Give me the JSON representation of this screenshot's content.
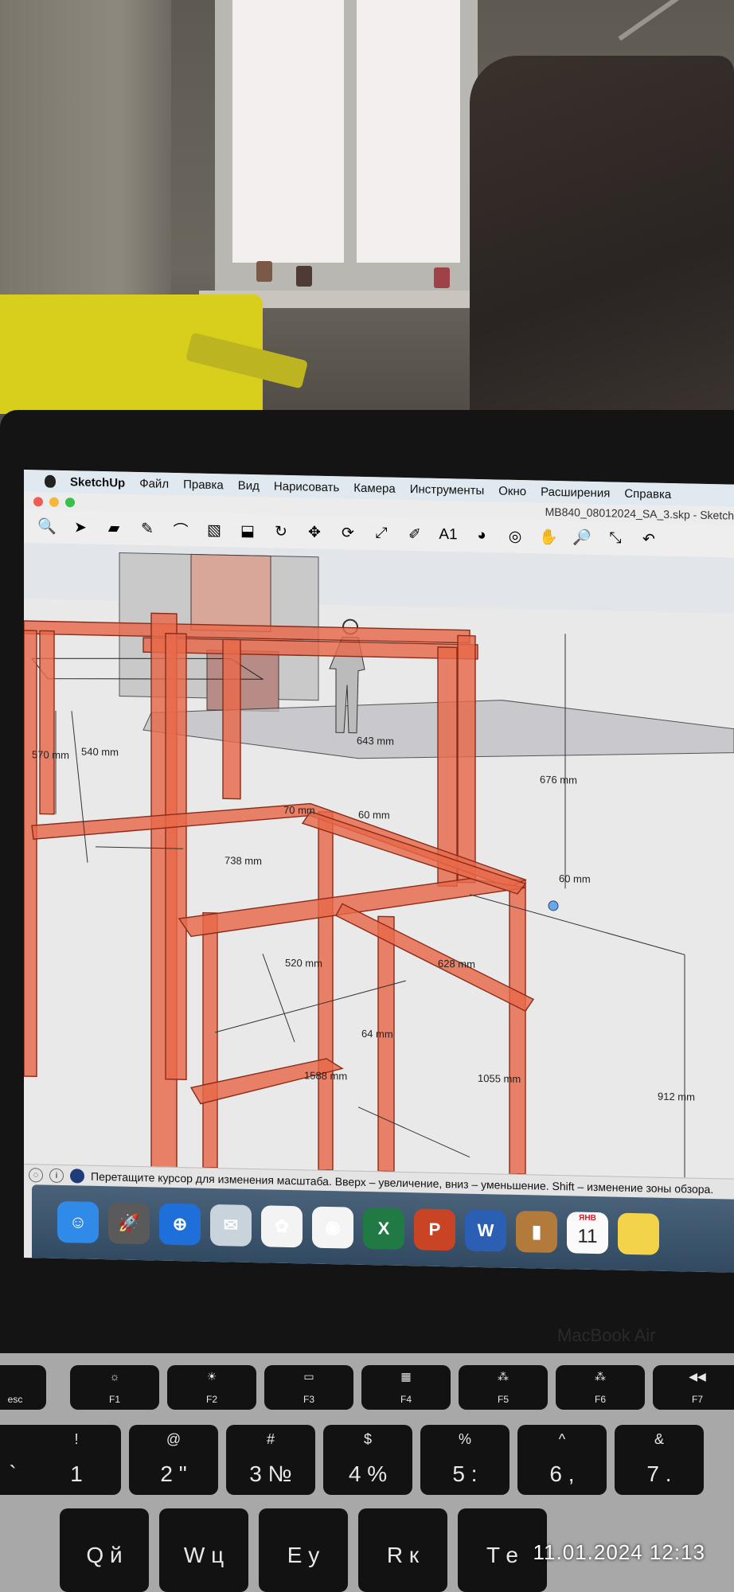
{
  "menubar": {
    "app_name": "SketchUp",
    "items": [
      "Файл",
      "Правка",
      "Вид",
      "Нарисовать",
      "Камера",
      "Инструменты",
      "Окно",
      "Расширения",
      "Справка"
    ]
  },
  "window": {
    "document_title": "MB840_08012024_SA_3.skp - Sketch"
  },
  "toolbar": {
    "tools": [
      {
        "name": "zoom-icon",
        "glyph": "🔍"
      },
      {
        "name": "select-arrow-icon",
        "glyph": "➤"
      },
      {
        "name": "eraser-icon",
        "glyph": "▰"
      },
      {
        "name": "pencil-icon",
        "glyph": "✎"
      },
      {
        "name": "arc-icon",
        "glyph": "⌒"
      },
      {
        "name": "rectangle-icon",
        "glyph": "▧"
      },
      {
        "name": "push-pull-icon",
        "glyph": "⬓"
      },
      {
        "name": "follow-me-icon",
        "glyph": "↻"
      },
      {
        "name": "move-icon",
        "glyph": "✥"
      },
      {
        "name": "rotate-icon",
        "glyph": "⟳"
      },
      {
        "name": "scale-icon",
        "glyph": "⤢"
      },
      {
        "name": "tape-measure-icon",
        "glyph": "✐"
      },
      {
        "name": "text-icon",
        "glyph": "A1"
      },
      {
        "name": "paint-bucket-icon",
        "glyph": "◕"
      },
      {
        "name": "orbit-icon",
        "glyph": "◎"
      },
      {
        "name": "pan-icon",
        "glyph": "✋"
      },
      {
        "name": "zoom-tool-icon",
        "glyph": "🔎"
      },
      {
        "name": "zoom-extents-icon",
        "glyph": "⤡"
      },
      {
        "name": "undo-icon",
        "glyph": "↶"
      }
    ]
  },
  "viewport": {
    "dimensions": [
      "570 mm",
      "540 mm",
      "643 mm",
      "676 mm",
      "70 mm",
      "60 mm",
      "738 mm",
      "60 mm",
      "520 mm",
      "628 mm",
      "64 mm",
      "1588 mm",
      "1055 mm",
      "912 mm"
    ]
  },
  "statusbar": {
    "hint": "Перетащите курсор для изменения масштаба.  Вверх – увеличение, вниз – уменьшение. Shift – изменение зоны обзора."
  },
  "dock": {
    "apps": [
      {
        "name": "finder-icon",
        "glyph": "☺",
        "color": "#2f8ae8"
      },
      {
        "name": "launchpad-icon",
        "glyph": "🚀",
        "color": "#5a5a5a"
      },
      {
        "name": "safari-icon",
        "glyph": "⊕",
        "color": "#1e6fd9"
      },
      {
        "name": "mail-icon",
        "glyph": "✉",
        "color": "#c9d3db"
      },
      {
        "name": "photos-icon",
        "glyph": "✿",
        "color": "#f3f3f3"
      },
      {
        "name": "chrome-icon",
        "glyph": "◉",
        "color": "#f4f4f4"
      },
      {
        "name": "excel-icon",
        "glyph": "X",
        "color": "#1f7a44"
      },
      {
        "name": "powerpoint-icon",
        "glyph": "P",
        "color": "#c84424"
      },
      {
        "name": "word-icon",
        "glyph": "W",
        "color": "#2b5fb4"
      },
      {
        "name": "contacts-icon",
        "glyph": "▮",
        "color": "#b27b3c"
      }
    ],
    "calendar": {
      "month": "ЯНВ",
      "day": "11"
    },
    "notes_color": "#f3d34a"
  },
  "laptop": {
    "brand": "MacBook Air"
  },
  "keyboard": {
    "fn_row": [
      {
        "label": "esc",
        "icon": ""
      },
      {
        "label": "F1",
        "icon": "☼"
      },
      {
        "label": "F2",
        "icon": "☀"
      },
      {
        "label": "F3",
        "icon": "▭"
      },
      {
        "label": "F4",
        "icon": "▦"
      },
      {
        "label": "F5",
        "icon": "⁂"
      },
      {
        "label": "F6",
        "icon": "⁂"
      },
      {
        "label": "F7",
        "icon": "◀◀"
      }
    ],
    "num_row": [
      {
        "top": "",
        "main": "`"
      },
      {
        "top": "!",
        "main": "1"
      },
      {
        "top": "@",
        "main": "2 \""
      },
      {
        "top": "#",
        "main": "3 №"
      },
      {
        "top": "$",
        "main": "4 %"
      },
      {
        "top": "%",
        "main": "5 :"
      },
      {
        "top": "^",
        "main": "6 ,"
      },
      {
        "top": "&",
        "main": "7 ."
      }
    ],
    "letter_row": [
      {
        "main": "Q й"
      },
      {
        "main": "W ц"
      },
      {
        "main": "E у"
      },
      {
        "main": "R к"
      },
      {
        "main": "T е"
      }
    ]
  },
  "photo_timestamp": "11.01.2024   12:13"
}
